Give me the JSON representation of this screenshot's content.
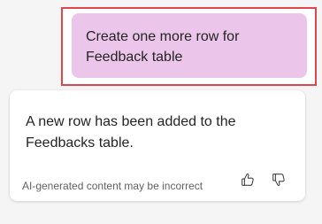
{
  "user_message": {
    "text": "Create one more row for Feedback table"
  },
  "bot_message": {
    "text": "A new row has been added to the Feedbacks table.",
    "disclaimer": "AI-generated content may be incorrect"
  },
  "actions": {
    "thumbs_up_icon": "thumbs-up-icon",
    "thumbs_down_icon": "thumbs-down-icon"
  },
  "colors": {
    "user_bubble": "#ebc6ea",
    "highlight_border": "#e0474c",
    "background": "#f5f5f5"
  }
}
